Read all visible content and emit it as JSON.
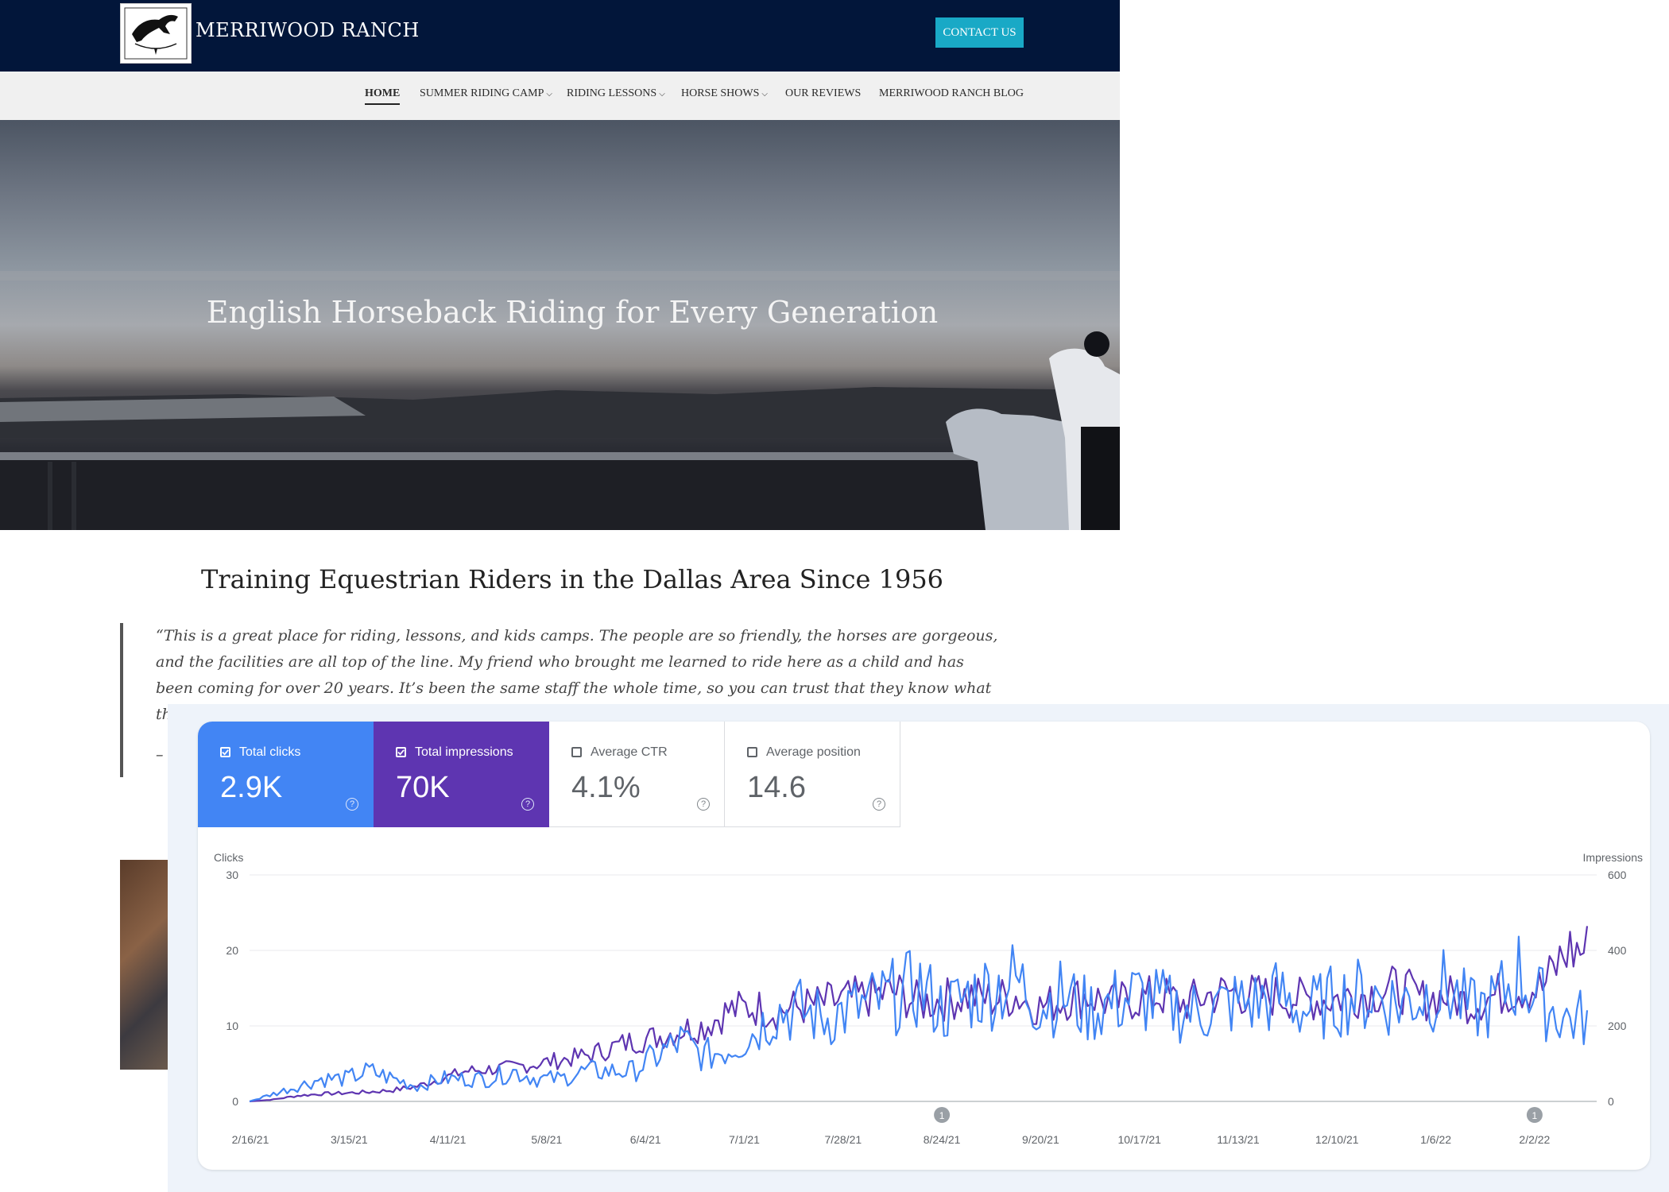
{
  "site": {
    "brand": "MERRIWOOD RANCH",
    "contact_label": "CONTACT US",
    "nav": [
      {
        "label": "HOME",
        "caret": false
      },
      {
        "label": "SUMMER RIDING CAMP",
        "caret": true
      },
      {
        "label": "RIDING LESSONS",
        "caret": true
      },
      {
        "label": "HORSE SHOWS",
        "caret": true
      },
      {
        "label": "OUR REVIEWS",
        "caret": false
      },
      {
        "label": "MERRIWOOD RANCH BLOG",
        "caret": false
      }
    ],
    "hero_title": "English Horseback Riding for Every Generation",
    "subhead": "Training Equestrian Riders in the Dallas Area Since 1956",
    "quote": "“This is a great place for riding, lessons, and kids camps. The people are so friendly, the horses are gorgeous, and the facilities are all top of the line. My friend who brought me learned to ride here as a child and has been coming for over 20 years. It’s been the same staff the whole time, so you can trust that they know what they’re doing. The horses were simply majestic and a lot of fu",
    "quote_tail": "–"
  },
  "gsc": {
    "metrics": [
      {
        "label": "Total clicks",
        "value": "2.9K",
        "checked": true,
        "color": "#4285f4"
      },
      {
        "label": "Total impressions",
        "value": "70K",
        "checked": true,
        "color": "#5e35b1"
      },
      {
        "label": "Average CTR",
        "value": "4.1%",
        "checked": false
      },
      {
        "label": "Average position",
        "value": "14.6",
        "checked": false
      }
    ],
    "help_glyph": "?"
  },
  "chart_data": {
    "type": "line",
    "ylabel_left": "Clicks",
    "ylabel_right": "Impressions",
    "ylim_left": [
      0,
      30
    ],
    "ylim_right": [
      0,
      600
    ],
    "yticks_left": [
      "0",
      "10",
      "20",
      "30"
    ],
    "yticks_right": [
      "0",
      "200",
      "400",
      "600"
    ],
    "x_tick_labels": [
      "2/16/21",
      "3/15/21",
      "4/11/21",
      "5/8/21",
      "6/4/21",
      "7/1/21",
      "7/28/21",
      "8/24/21",
      "9/20/21",
      "10/17/21",
      "11/13/21",
      "12/10/21",
      "1/6/22",
      "2/2/22"
    ],
    "annotations": [
      {
        "x_tick": "8/24/21",
        "label": "1"
      },
      {
        "x_tick": "2/2/22",
        "label": "1"
      }
    ],
    "grid": true,
    "series": [
      {
        "name": "Clicks",
        "axis": "left",
        "color": "#4285f4",
        "approx_weekly_values": [
          0,
          1,
          2,
          3,
          3,
          4,
          3,
          2,
          3,
          3,
          3,
          4,
          3,
          3,
          4,
          4,
          4,
          6,
          8,
          6,
          7,
          9,
          12,
          12,
          11,
          12,
          13,
          14,
          15,
          12,
          14,
          15,
          16,
          13,
          14,
          12,
          13,
          14,
          13,
          12,
          12,
          13,
          13,
          14,
          12,
          13,
          14,
          14,
          13,
          14,
          15,
          12,
          13,
          17,
          13,
          11
        ]
      },
      {
        "name": "Impressions",
        "axis": "right",
        "color": "#5e35b1",
        "approx_weekly_values": [
          0,
          5,
          15,
          20,
          22,
          25,
          30,
          40,
          60,
          80,
          85,
          90,
          100,
          110,
          120,
          140,
          160,
          170,
          190,
          200,
          240,
          250,
          240,
          250,
          260,
          270,
          280,
          290,
          260,
          270,
          280,
          270,
          280,
          250,
          270,
          280,
          260,
          270,
          280,
          260,
          280,
          290,
          280,
          280,
          270,
          270,
          280,
          290,
          300,
          270,
          280,
          260,
          280,
          300,
          300,
          400
        ]
      }
    ]
  }
}
